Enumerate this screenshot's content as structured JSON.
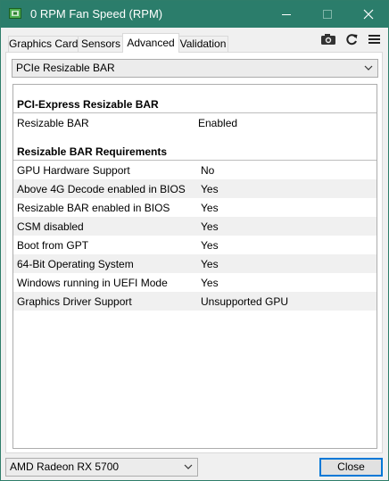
{
  "window": {
    "title": "0 RPM Fan Speed (RPM)"
  },
  "tabs": [
    {
      "label": "Graphics Card"
    },
    {
      "label": "Sensors"
    },
    {
      "label": "Advanced"
    },
    {
      "label": "Validation"
    }
  ],
  "toolbar": {
    "icons": [
      "camera-icon",
      "refresh-icon",
      "hamburger-menu-icon"
    ]
  },
  "section_select": {
    "value": "PCIe Resizable BAR"
  },
  "sections": {
    "pcie": {
      "title": "PCI-Express Resizable BAR",
      "rows": [
        {
          "key": "Resizable BAR",
          "value": "Enabled"
        }
      ]
    },
    "requirements": {
      "title": "Resizable BAR Requirements",
      "rows": [
        {
          "key": "GPU Hardware Support",
          "value": "No"
        },
        {
          "key": "Above 4G Decode enabled in BIOS",
          "value": "Yes"
        },
        {
          "key": "Resizable BAR enabled in BIOS",
          "value": "Yes"
        },
        {
          "key": "CSM disabled",
          "value": "Yes"
        },
        {
          "key": "Boot from GPT",
          "value": "Yes"
        },
        {
          "key": "64-Bit Operating System",
          "value": "Yes"
        },
        {
          "key": "Windows running in UEFI Mode",
          "value": "Yes"
        },
        {
          "key": "Graphics Driver Support",
          "value": "Unsupported GPU"
        }
      ]
    }
  },
  "footer": {
    "gpu_select_value": "AMD Radeon RX 5700",
    "close_label": "Close"
  },
  "colors": {
    "titlebar": "#2b7d6b",
    "alt_row": "#f0f0f0",
    "accent_border": "#0078d7"
  }
}
